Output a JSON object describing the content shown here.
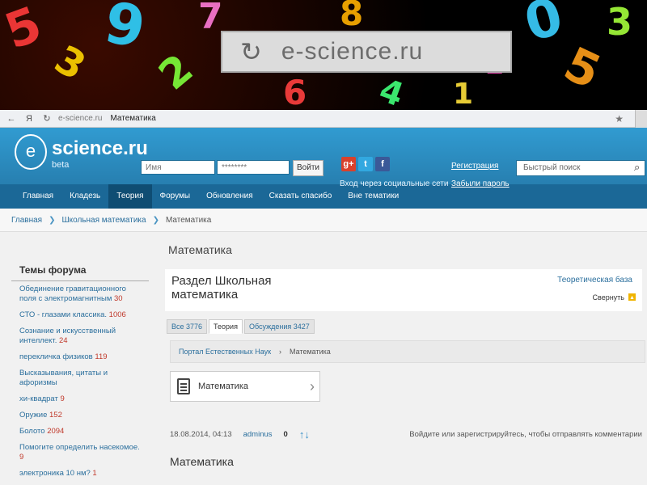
{
  "banner": {
    "site": "e-science.ru"
  },
  "browser": {
    "back": "←",
    "home": "Я",
    "url": "e-science.ru",
    "title": "Математика",
    "star": "★"
  },
  "header": {
    "brand": "science.ru",
    "beta": "beta",
    "login_placeholder": "Имя",
    "password_placeholder": "********",
    "login_button": "Войти",
    "social_text": "Вход через социальные сети",
    "register": "Регистрация",
    "forgot": "Забыли пароль",
    "search_placeholder": "Быстрый поиск"
  },
  "menu": [
    "Главная",
    "Кладезь",
    "Теория",
    "Форумы",
    "Обновления",
    "Сказать спасибо",
    "Вне тематики"
  ],
  "breadcrumb": [
    "Главная",
    "Школьная математика",
    "Математика"
  ],
  "sidebar": {
    "title": "Темы форума",
    "topics": [
      {
        "label": "Обединение гравитационного поля с электромагнитным",
        "count": "30"
      },
      {
        "label": "СТО - глазами классика.",
        "count": "1006"
      },
      {
        "label": "Сознание и искусственный интеллект.",
        "count": "24"
      },
      {
        "label": "перекличка физиков",
        "count": "119"
      },
      {
        "label": "Высказывания, цитаты и афоризмы",
        "count": ""
      },
      {
        "label": "хи-квадрат",
        "count": "9"
      },
      {
        "label": "Оружие",
        "count": "152"
      },
      {
        "label": "Болото",
        "count": "2094"
      },
      {
        "label": "Помогите определить насекомое.",
        "count": "9"
      },
      {
        "label": "электроника 10 нм?",
        "count": "1"
      }
    ]
  },
  "main": {
    "page_title": "Математика",
    "section_title": "Раздел Школьная математика",
    "theory_link": "Теоретическая база",
    "collapse": "Свернуть",
    "tabs": [
      "Все 3776",
      "Теория",
      "Обсуждения 3427"
    ],
    "portal_link": "Портал Естественных Наук",
    "portal_current": "Математика",
    "category": "Математика",
    "post_date": "18.08.2014, 04:13",
    "post_author": "adminus",
    "post_votes": "0",
    "post_reply": "Войдите или зарегистрируйтесь, чтобы отправлять комментарии",
    "post_title": "Математика"
  }
}
